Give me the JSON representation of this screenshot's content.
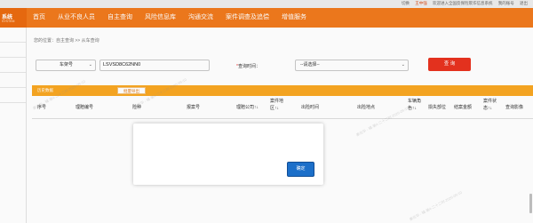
{
  "topbar": {
    "switch_label": "切换",
    "user_label": "王中强",
    "welcome_text": "欢迎进入全国反保险欺诈信息系统",
    "account_label": "我的账号",
    "logout_label": "退出"
  },
  "header": {
    "logo_text": "系统",
    "logo_subtext": "SYSTEM"
  },
  "nav": {
    "items": [
      {
        "label": "首页"
      },
      {
        "label": "从业不良人员"
      },
      {
        "label": "自主查询"
      },
      {
        "label": "风险信息库"
      },
      {
        "label": "沟通交流"
      },
      {
        "label": "案件调查及追偿"
      },
      {
        "label": "增值服务"
      }
    ]
  },
  "breadcrumb": "您的位置：自主查询 >> 从车查询",
  "form": {
    "query_type": "车架号",
    "vin_value": "LSVSD8C62NN0",
    "time_label": "查询时间：",
    "time_required": "*",
    "time_select": "--请选择--",
    "search_label": "查 询"
  },
  "panel": {
    "title": "历史数据",
    "export_label": "批量导出"
  },
  "table": {
    "headers": [
      {
        "label": "序号"
      },
      {
        "label": "理赔编号"
      },
      {
        "label": "险种"
      },
      {
        "label": "报案号"
      },
      {
        "label": "理赔公司↑↓"
      },
      {
        "label": "案件地区↑↓"
      },
      {
        "label": "出险时间"
      },
      {
        "label": "出险地点"
      },
      {
        "label": "车辆角色↑↓"
      },
      {
        "label": "损失部位"
      },
      {
        "label": "结案金额"
      },
      {
        "label": "案件状态↑↓"
      },
      {
        "label": "查询影像"
      }
    ]
  },
  "dialog": {
    "ok_label": "确定"
  },
  "watermark": "秦兆华 - 辅-第4-二十二时-2026-09-10"
}
